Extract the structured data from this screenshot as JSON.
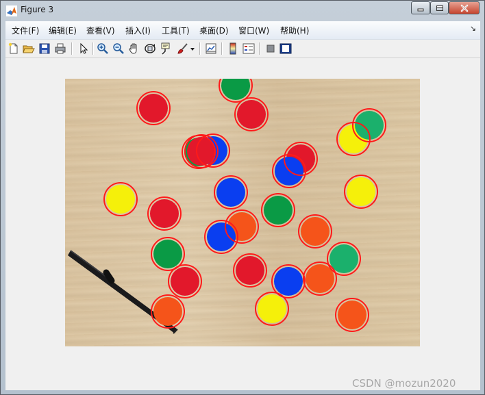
{
  "window": {
    "title": "Figure 3",
    "controls": [
      "minimize-icon",
      "maximize-icon",
      "close-icon"
    ]
  },
  "menubar": {
    "items": [
      "文件(F)",
      "编辑(E)",
      "查看(V)",
      "插入(I)",
      "工具(T)",
      "桌面(D)",
      "窗口(W)",
      "帮助(H)"
    ],
    "arrow": "↘"
  },
  "toolbar": {
    "tools": [
      "new-figure-icon",
      "open-file-icon",
      "save-icon",
      "print-icon",
      "edit-plot-arrow-icon",
      "zoom-in-icon",
      "zoom-out-icon",
      "pan-hand-icon",
      "rotate-3d-icon",
      "data-cursor-icon",
      "brush-icon",
      "brush-dropdown-icon",
      "link-plot-icon",
      "colorbar-icon",
      "legend-icon",
      "hide-plot-tools-icon",
      "show-plot-tools-icon"
    ]
  },
  "figure": {
    "image_content": "photo of colored chips (red, green, blue, yellow, orange) on a wooden table with a black pen; detected circles outlined in red",
    "outline_color": "#ff1a1a",
    "chip_colors": {
      "red": "#e2182b",
      "green": "#0a9a45",
      "blue": "#0a3ef0",
      "yellow": "#f5f00a",
      "orange": "#f5541a",
      "teal": "#1bb06c"
    }
  },
  "watermark": "CSDN @mozun2020"
}
